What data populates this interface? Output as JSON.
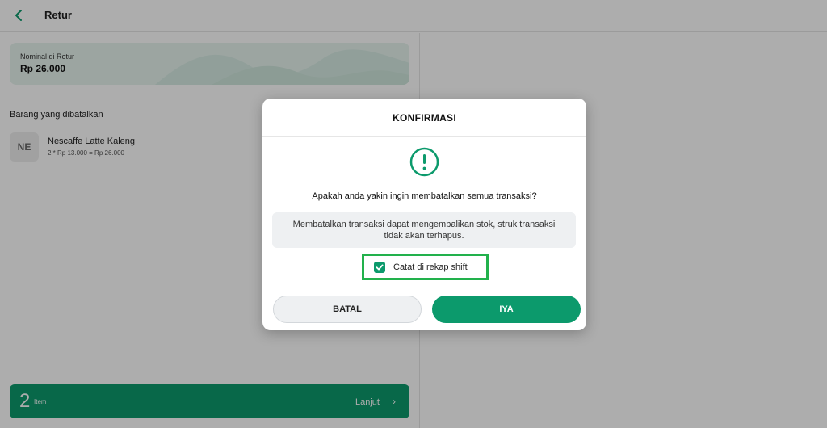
{
  "header": {
    "title": "Retur"
  },
  "nominal": {
    "label": "Nominal di Retur",
    "value": "Rp 26.000"
  },
  "section": {
    "title": "Barang yang dibatalkan"
  },
  "item": {
    "avatar_text": "NE",
    "name": "Nescaffe Latte Kaleng",
    "detail": "2 * Rp 13.000 = Rp 26.000"
  },
  "footer": {
    "count": "2",
    "count_label": "Item",
    "next_label": "Lanjut",
    "next_icon": "chevron-right-icon"
  },
  "modal": {
    "title": "KONFIRMASI",
    "icon": "exclamation-circle-icon",
    "question": "Apakah anda yakin ingin membatalkan semua transaksi?",
    "info": "Membatalkan transaksi dapat mengembalikan stok, struk transaksi tidak akan terhapus.",
    "checkbox_label": "Catat di rekap shift",
    "checkbox_checked": true,
    "cancel_label": "BATAL",
    "confirm_label": "IYA"
  },
  "colors": {
    "accent": "#0c9a6c",
    "highlight": "#22b14c"
  }
}
